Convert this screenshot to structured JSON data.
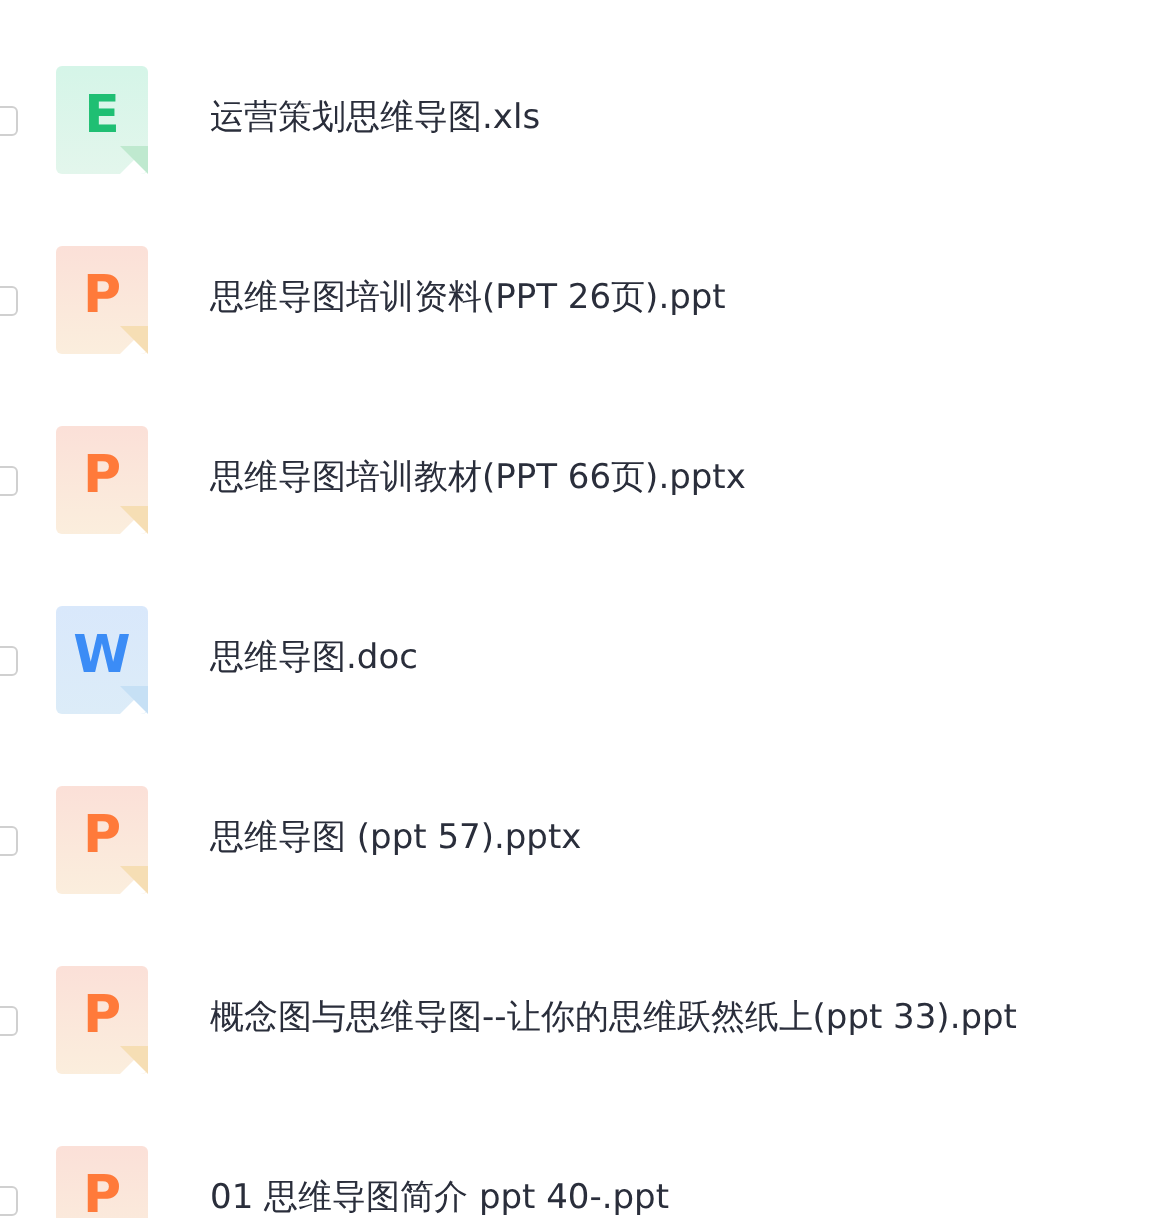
{
  "files": [
    {
      "kind": "xls",
      "letter": "E",
      "name": "运营策划思维导图.xls",
      "checked": false
    },
    {
      "kind": "ppt",
      "letter": "P",
      "name": "思维导图培训资料(PPT 26页).ppt",
      "checked": false
    },
    {
      "kind": "ppt",
      "letter": "P",
      "name": "思维导图培训教材(PPT 66页).pptx",
      "checked": false
    },
    {
      "kind": "doc",
      "letter": "W",
      "name": "思维导图.doc",
      "checked": false
    },
    {
      "kind": "ppt",
      "letter": "P",
      "name": "思维导图 (ppt 57).pptx",
      "checked": false
    },
    {
      "kind": "ppt",
      "letter": "P",
      "name": "概念图与思维导图--让你的思维跃然纸上(ppt 33).ppt",
      "checked": false
    },
    {
      "kind": "ppt",
      "letter": "P",
      "name": "01 思维导图简介 ppt 40-.ppt",
      "checked": false
    }
  ]
}
